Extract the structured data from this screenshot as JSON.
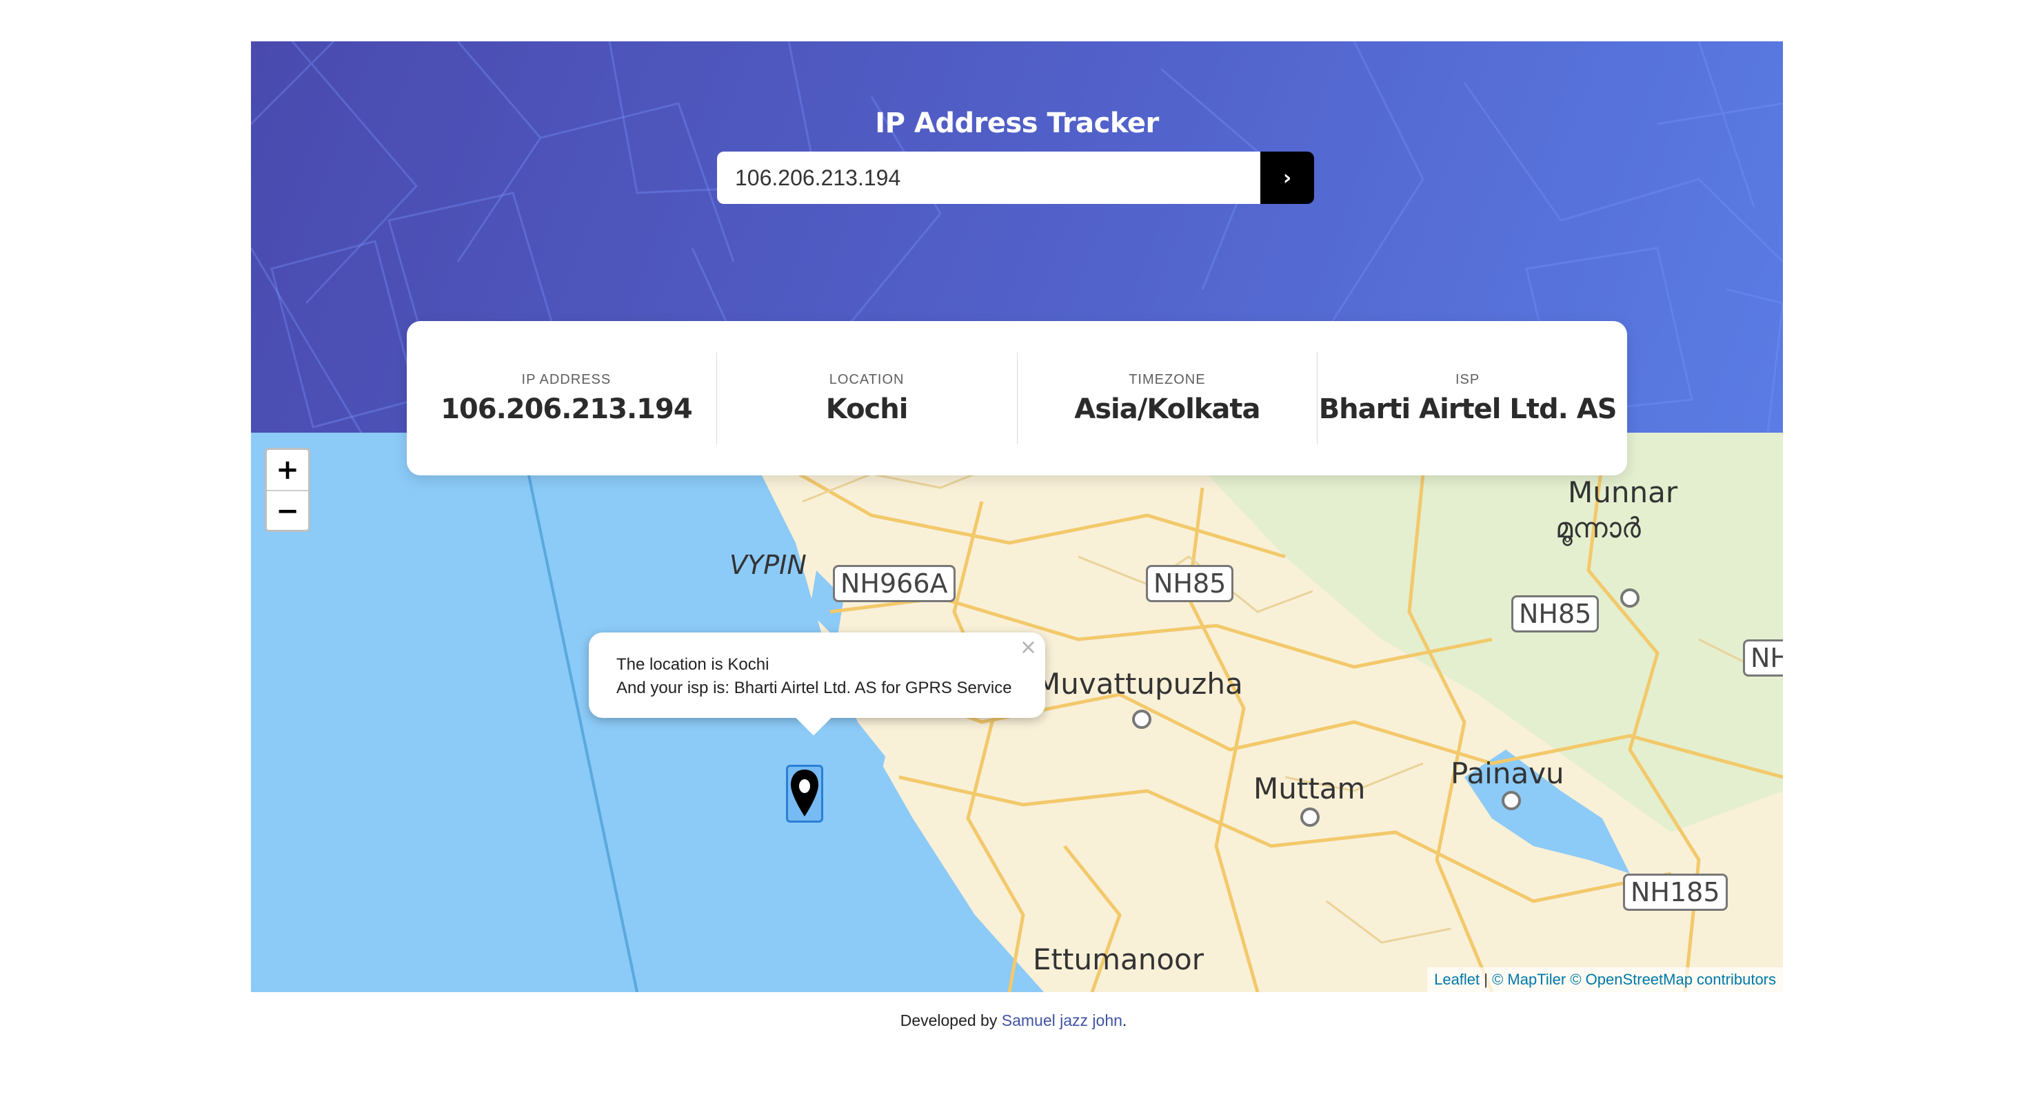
{
  "header": {
    "title": "IP Address Tracker",
    "search_value": "106.206.213.194",
    "submit_icon": "chevron-right-icon",
    "submit_label": "›"
  },
  "info": [
    {
      "label": "IP ADDRESS",
      "value": "106.206.213.194"
    },
    {
      "label": "LOCATION",
      "value": "Kochi"
    },
    {
      "label": "TIMEZONE",
      "value": "Asia/Kolkata"
    },
    {
      "label": "ISP",
      "value": "Bharti Airtel Ltd. AS"
    }
  ],
  "map": {
    "zoom_in": "+",
    "zoom_out": "−",
    "places": {
      "munnar": "Munnar",
      "munnar_ml": "മൂന്നാർ",
      "vypin": "VYPIN",
      "muvattupuzha": "Muvattupuzha",
      "muttam": "Muttam",
      "painavu": "Painavu",
      "ettumanoor": "Ettumanoor"
    },
    "roads": {
      "nh966a": "NH966A",
      "nh85_a": "NH85",
      "nh85_b": "NH85",
      "nh_edge": "NH",
      "nh185": "NH185"
    },
    "popup": {
      "line1": "The location is Kochi",
      "line2": "And your isp is: Bharti Airtel Ltd. AS for GPRS Service",
      "close": "×"
    },
    "marker_icon": "map-pin-icon",
    "attribution": {
      "leaflet": "Leaflet",
      "separator": " | ",
      "maptiler": "© MapTiler",
      "osm": "© OpenStreetMap contributors"
    }
  },
  "footer": {
    "prefix": "Developed by ",
    "author": "Samuel jazz john",
    "suffix": "."
  },
  "colors": {
    "header_start": "#4a4aae",
    "header_end": "#5a7ce4",
    "sea": "#8ccaf7",
    "land": "#f9f0d8",
    "roads": "#f2c96b"
  }
}
